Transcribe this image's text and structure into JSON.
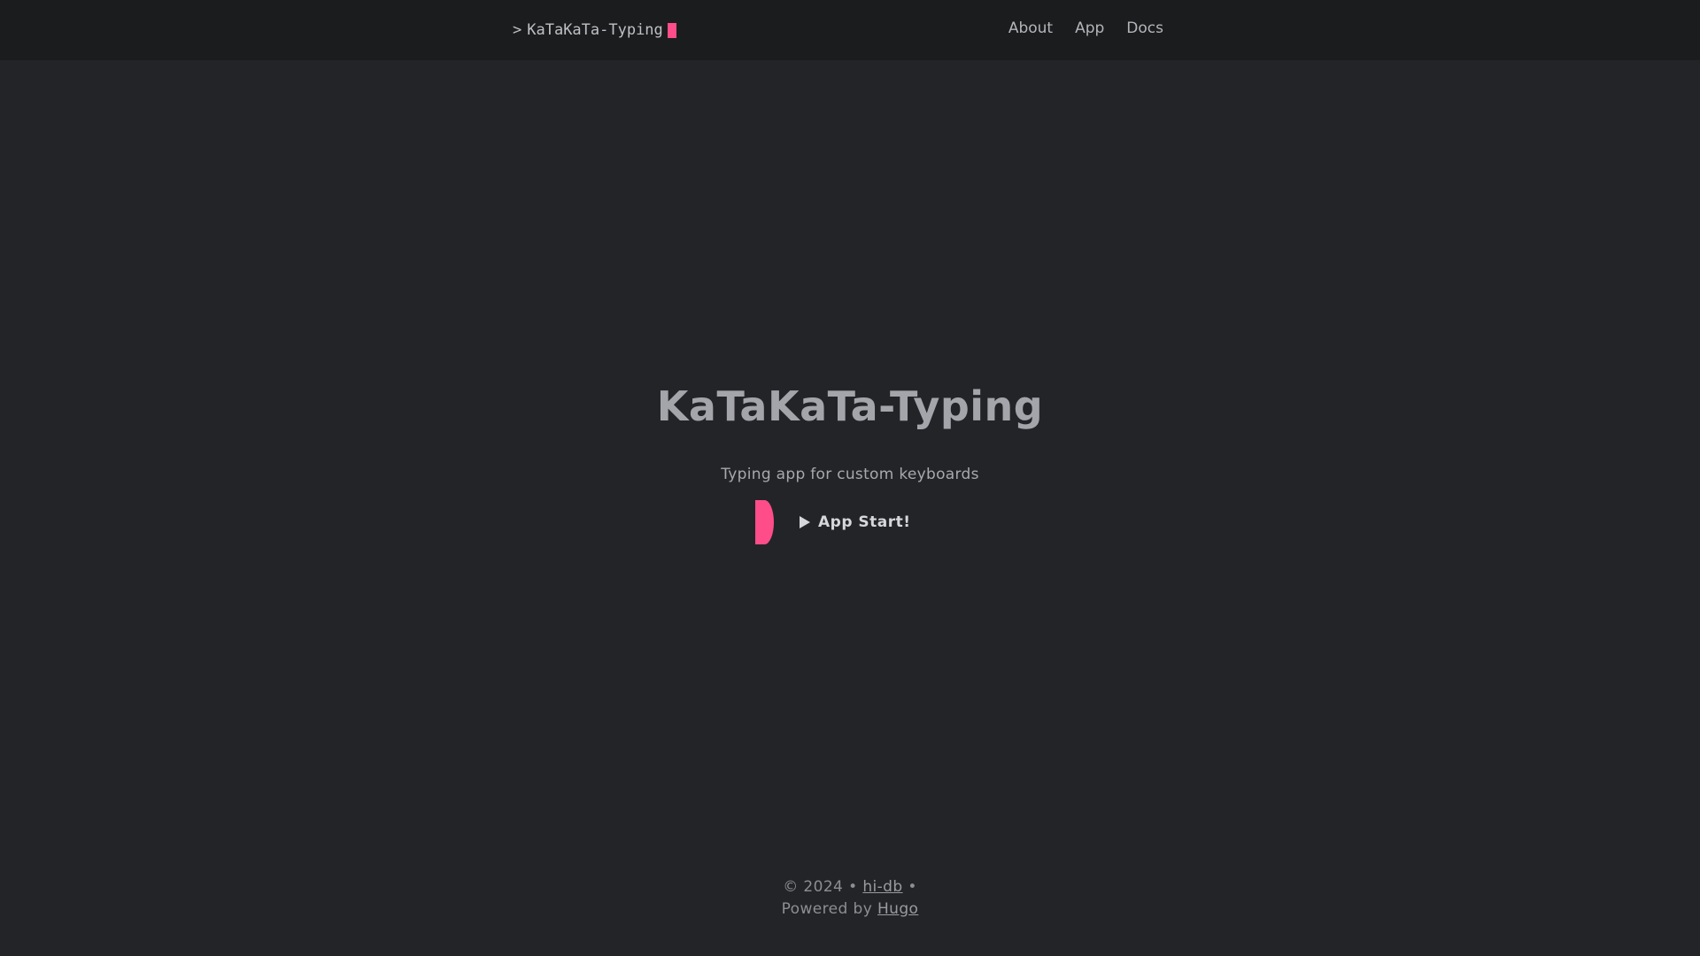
{
  "header": {
    "logo_prompt": ">",
    "logo_text": "KaTaKaTa-Typing",
    "nav": [
      {
        "label": "About"
      },
      {
        "label": "App"
      },
      {
        "label": "Docs"
      }
    ]
  },
  "hero": {
    "title": "KaTaKaTa-Typing",
    "subtitle": "Typing app for custom keyboards",
    "start_label": "App Start!"
  },
  "footer": {
    "copyright_prefix": "© 2024 •",
    "author_link": "hi-db",
    "separator": "•",
    "powered_prefix": "Powered by",
    "powered_link": "Hugo"
  },
  "colors": {
    "background": "#232427",
    "header_background": "#1b1c1e",
    "accent": "#ff4d8a"
  },
  "icons": {
    "start": "play-icon"
  }
}
